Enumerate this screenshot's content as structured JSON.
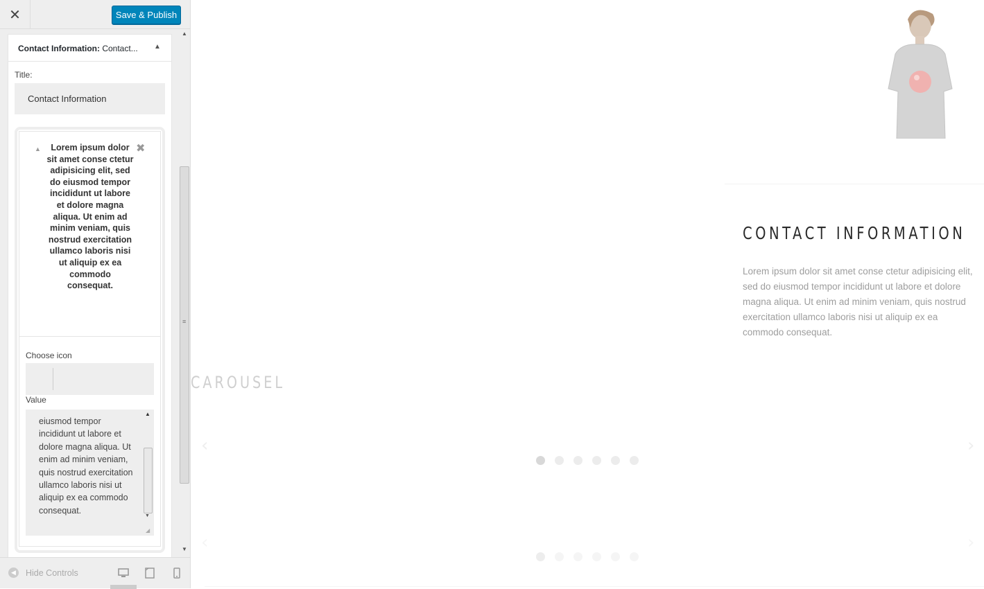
{
  "header": {
    "close_label": "×",
    "save_label": "Save & Publish"
  },
  "widget": {
    "title_bold": "Contact Information:",
    "title_suffix": " Contact...",
    "title_field_label": "Title:",
    "title_field_value": "Contact Information",
    "item": {
      "heading": "Lorem ipsum dolor sit amet conse ctetur adipisicing elit, sed do eiusmod tempor incididunt ut labore et dolore magna aliqua. Ut enim ad minim veniam, quis nostrud exercitation ullamco laboris nisi ut aliquip ex ea commodo consequat.",
      "choose_icon_label": "Choose icon",
      "value_label": "Value",
      "value_text": "eiusmod tempor incididunt ut labore et dolore magna aliqua. Ut enim ad minim veniam, quis nostrud exercitation ullamco laboris nisi ut aliquip ex ea commodo consequat."
    }
  },
  "footer": {
    "hide_controls_label": "Hide Controls",
    "devices": [
      "desktop-icon",
      "tablet-icon",
      "mobile-icon"
    ],
    "active_device": "desktop"
  },
  "preview": {
    "contact_heading": "CONTACT INFORMATION",
    "contact_text": "Lorem ipsum dolor sit amet conse ctetur adipisicing elit, sed do eiusmod tempor incididunt ut labore et dolore magna aliqua. Ut enim ad minim veniam, quis nostrud exercitation ullamco laboris nisi ut aliquip ex ea commodo consequat.",
    "carousel_title": "CAROUSEL",
    "carousel_dots": 6,
    "active_dot": 1
  },
  "colors": {
    "primary_button": "#0085ba",
    "sidebar_bg": "#eeeeee",
    "heading_text": "#2a2a2a",
    "body_text": "#9d9d9d"
  }
}
